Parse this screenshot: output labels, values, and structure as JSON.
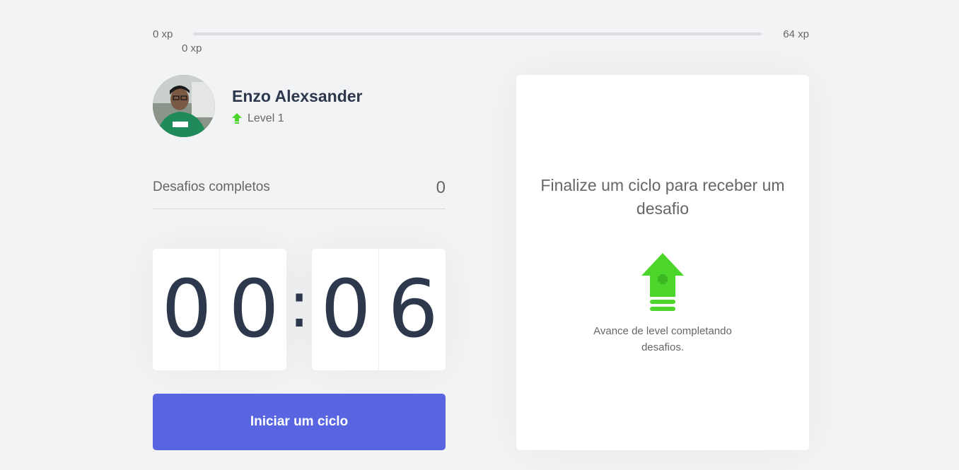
{
  "xp": {
    "start_label": "0 xp",
    "end_label": "64 xp",
    "current_label": "0 xp",
    "progress_fraction": 0,
    "fill_color": "#4cd62b"
  },
  "profile": {
    "name": "Enzo Alexsander",
    "level_label": "Level 1",
    "level_icon": "level-up-arrow-icon"
  },
  "challenges": {
    "label": "Desafios completos",
    "count": "0"
  },
  "countdown": {
    "minute_left": "0",
    "minute_right": "0",
    "separator": ":",
    "second_left": "0",
    "second_right": "6"
  },
  "start_button": {
    "label": "Iniciar um ciclo",
    "color": "#5965e0"
  },
  "challenge_box": {
    "title": "Finalize um ciclo para receber um desafio",
    "icon": "level-up-icon",
    "description": "Avance de level completando desafios."
  }
}
